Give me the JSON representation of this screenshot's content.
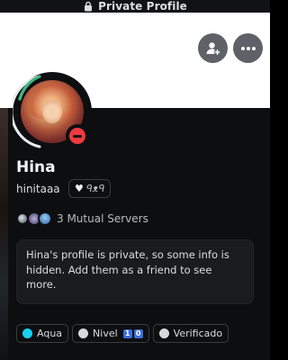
{
  "header": {
    "title": "Private Profile"
  },
  "actions": {
    "add_friend_icon": "add-friend-icon",
    "more_icon": "more-icon"
  },
  "profile": {
    "display_name": "Hina",
    "username": "hinitaaa",
    "pronouns": "ᑫᴥᑫ",
    "status": "do-not-disturb",
    "status_color": "#ed3b40"
  },
  "mutual": {
    "label": "3 Mutual Servers"
  },
  "notice": {
    "text": "Hina's profile is private, so some info is hidden. Add them as a friend to see more."
  },
  "roles": [
    {
      "label": "Aqua",
      "color": "#17d1f2"
    },
    {
      "label": "Nivel",
      "color": "#d9d9d9",
      "chips": [
        "1",
        "0"
      ]
    },
    {
      "label": "Verificado",
      "color": "#d9d9d9"
    }
  ]
}
